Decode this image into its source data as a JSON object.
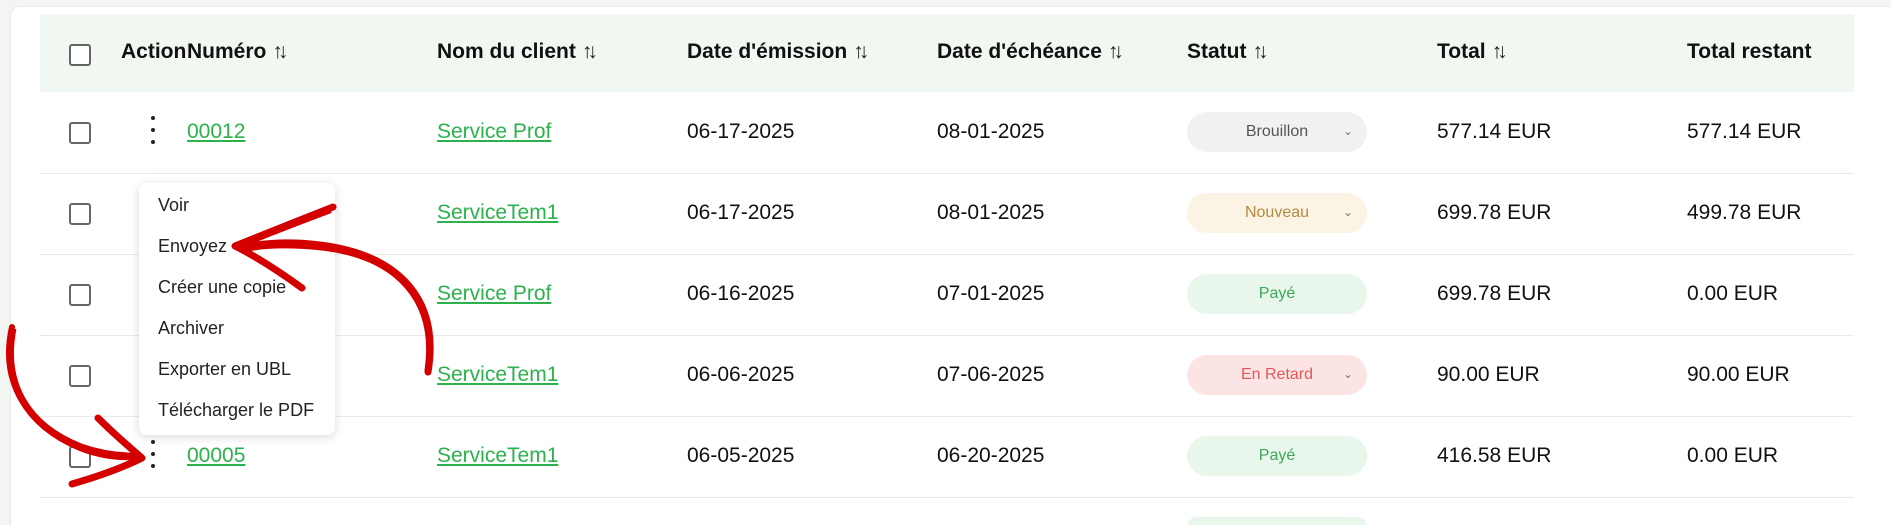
{
  "table": {
    "headers": {
      "select_all": "",
      "action": "Action",
      "numero": "Numéro",
      "client": "Nom du client",
      "emission": "Date d'émission",
      "echeance": "Date d'échéance",
      "statut": "Statut",
      "total": "Total",
      "restant": "Total restant"
    },
    "sort_glyph": "↑↓",
    "rows": [
      {
        "numero": "00012",
        "client": "Service Prof",
        "emission": "06-17-2025",
        "echeance": "08-01-2025",
        "statut": "Brouillon",
        "total": "577.14 EUR",
        "restant": "577.14 EUR"
      },
      {
        "numero": "",
        "client": "ServiceTem1",
        "emission": "06-17-2025",
        "echeance": "08-01-2025",
        "statut": "Nouveau",
        "total": "699.78 EUR",
        "restant": "499.78 EUR"
      },
      {
        "numero": "",
        "client": "Service Prof",
        "emission": "06-16-2025",
        "echeance": "07-01-2025",
        "statut": "Payé",
        "total": "699.78 EUR",
        "restant": "0.00 EUR"
      },
      {
        "numero": "",
        "client": "ServiceTem1",
        "emission": "06-06-2025",
        "echeance": "07-06-2025",
        "statut": "En Retard",
        "total": "90.00 EUR",
        "restant": "90.00 EUR"
      },
      {
        "numero": "00005",
        "client": "ServiceTem1",
        "emission": "06-05-2025",
        "echeance": "06-20-2025",
        "statut": "Payé",
        "total": "416.58 EUR",
        "restant": "0.00 EUR"
      }
    ]
  },
  "action_menu": {
    "items": [
      "Voir",
      "Envoyez",
      "Créer une copie",
      "Archiver",
      "Exporter en UBL",
      "Télécharger le PDF"
    ]
  },
  "icons": {
    "sort": "sort-arrows-icon",
    "kebab": "kebab-menu-icon",
    "chevron": "chevron-down-icon",
    "annotation_arrow": "red-hand-drawn-arrow"
  },
  "colors": {
    "link": "#2bb24c",
    "header_bg": "#f1f8f2",
    "annotation": "#d40000"
  }
}
